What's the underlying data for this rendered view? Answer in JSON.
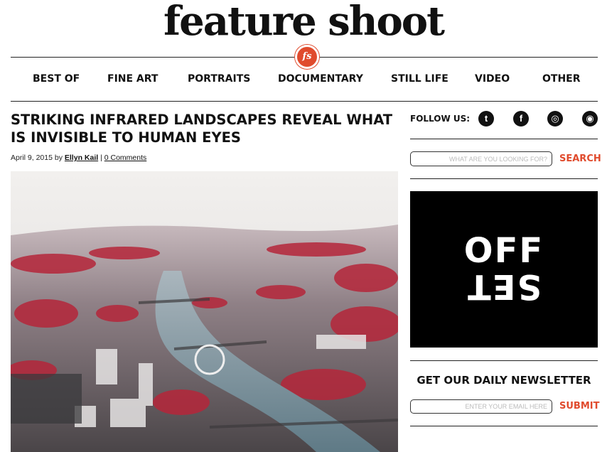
{
  "site": {
    "logo": "feature shoot",
    "badge": "fs"
  },
  "nav": {
    "items": [
      "BEST OF",
      "FINE ART",
      "PORTRAITS",
      "DOCUMENTARY",
      "STILL LIFE",
      "VIDEO",
      "OTHER"
    ]
  },
  "article": {
    "title": "STRIKING INFRARED LANDSCAPES REVEAL WHAT IS INVISIBLE TO HUMAN EYES",
    "date": "April 9, 2015 by",
    "author": "Ellyn Kail",
    "separator": "|",
    "comments": "0 Comments"
  },
  "sidebar": {
    "follow_label": "FOLLOW US:",
    "social": [
      {
        "name": "twitter-icon",
        "glyph": "t"
      },
      {
        "name": "facebook-icon",
        "glyph": "f"
      },
      {
        "name": "instagram-icon",
        "glyph": "◎"
      },
      {
        "name": "rss-icon",
        "glyph": "◉"
      }
    ],
    "search_placeholder": "WHAT ARE YOU LOOKING FOR?",
    "search_button": "SEARCH",
    "ad": {
      "line1": "OFF",
      "line2": "SET"
    },
    "newsletter_title": "GET OUR DAILY NEWSLETTER",
    "email_placeholder": "ENTER YOUR EMAIL HERE",
    "submit_button": "SUBMIT"
  },
  "colors": {
    "accent": "#e04b2d",
    "text": "#111111",
    "ad_bg": "#000000"
  }
}
